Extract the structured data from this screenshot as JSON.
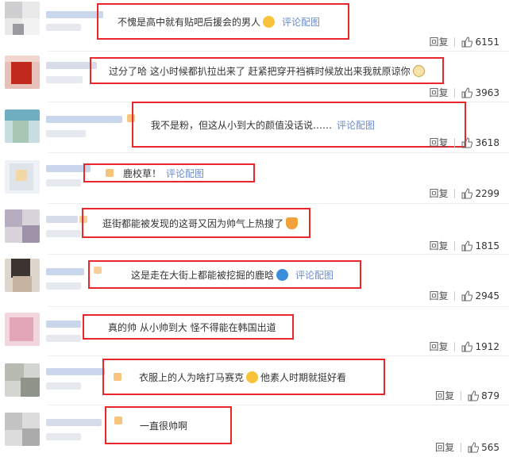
{
  "reply_label": "回复",
  "link_label": "评论配图",
  "comments": [
    {
      "text": "不愧是高中就有贴吧后援会的男人",
      "emoji": "smiling-face-with-heart-eyes-icon",
      "has_link": true,
      "likes": "6151"
    },
    {
      "text": "过分了哈 这小时候都扒拉出来了 赶紧把穿开裆裤时候放出来我就原谅你",
      "emoji": "cat-face-icon",
      "has_link": false,
      "likes": "3963"
    },
    {
      "text": "我不是粉，但这从小到大的颜值没话说……",
      "emoji": "",
      "has_link": true,
      "likes": "3618"
    },
    {
      "text": "鹿校草！",
      "emoji": "",
      "has_link": true,
      "likes": "2299"
    },
    {
      "text": "逛街都能被发现的这哥又因为帅气上热搜了",
      "emoji": "person-icon",
      "has_link": false,
      "likes": "1815"
    },
    {
      "text": "这是走在大街上都能被挖掘的鹿晗",
      "emoji": "doraemon-face-icon",
      "has_link": true,
      "likes": "2945"
    },
    {
      "text": "真的帅 从小帅到大 怪不得能在韩国出道",
      "emoji": "",
      "has_link": false,
      "likes": "1912"
    },
    {
      "text": "衣服上的人为啥打马赛克",
      "text_after": "他素人时期就挺好看",
      "emoji": "grinning-face-icon",
      "has_link": false,
      "likes": "879"
    },
    {
      "text": "一直很帅啊",
      "emoji": "",
      "has_link": false,
      "likes": "565"
    }
  ]
}
